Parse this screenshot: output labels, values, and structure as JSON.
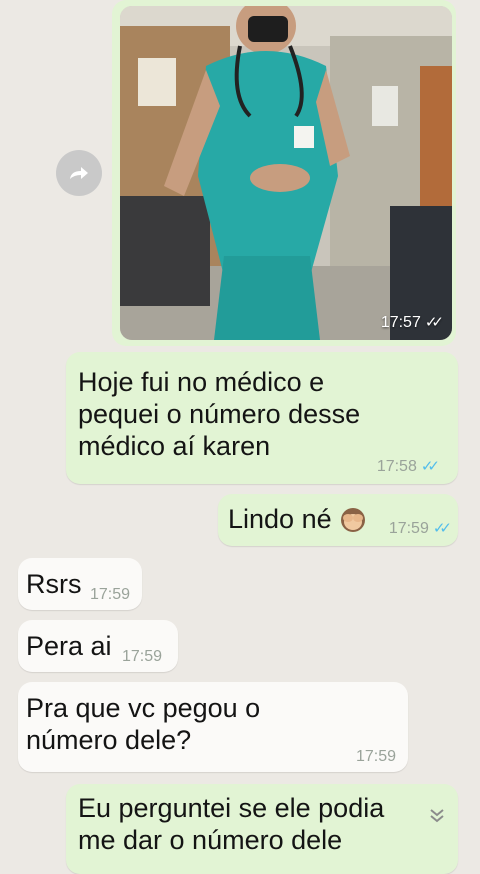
{
  "messages": [
    {
      "direction": "out",
      "type": "image",
      "time": "17:57"
    },
    {
      "direction": "out",
      "type": "text",
      "lines": [
        "Hoje fui no médico e",
        "pequei o número desse",
        "médico aí karen"
      ],
      "time": "17:58"
    },
    {
      "direction": "out",
      "type": "text",
      "text": "Lindo né",
      "emoji": "see-no-evil-monkey",
      "time": "17:59"
    },
    {
      "direction": "in",
      "type": "text",
      "text": "Rsrs",
      "time": "17:59"
    },
    {
      "direction": "in",
      "type": "text",
      "text": "Pera ai",
      "time": "17:59"
    },
    {
      "direction": "in",
      "type": "text",
      "lines": [
        "Pra que vc pegou o",
        "número dele?"
      ],
      "time": "17:59"
    },
    {
      "direction": "out",
      "type": "text",
      "lines": [
        "Eu perguntei se ele podia",
        "me dar o número dele"
      ]
    }
  ],
  "icons": {
    "forward": "forward-icon",
    "scroll_down": "chevron-down-icon",
    "read_receipt": "double-check-icon"
  },
  "colors": {
    "background": "#ece9e4",
    "outgoing": "#e2f4d4",
    "incoming": "#fbfaf8",
    "ticks": "#53bdeb"
  }
}
